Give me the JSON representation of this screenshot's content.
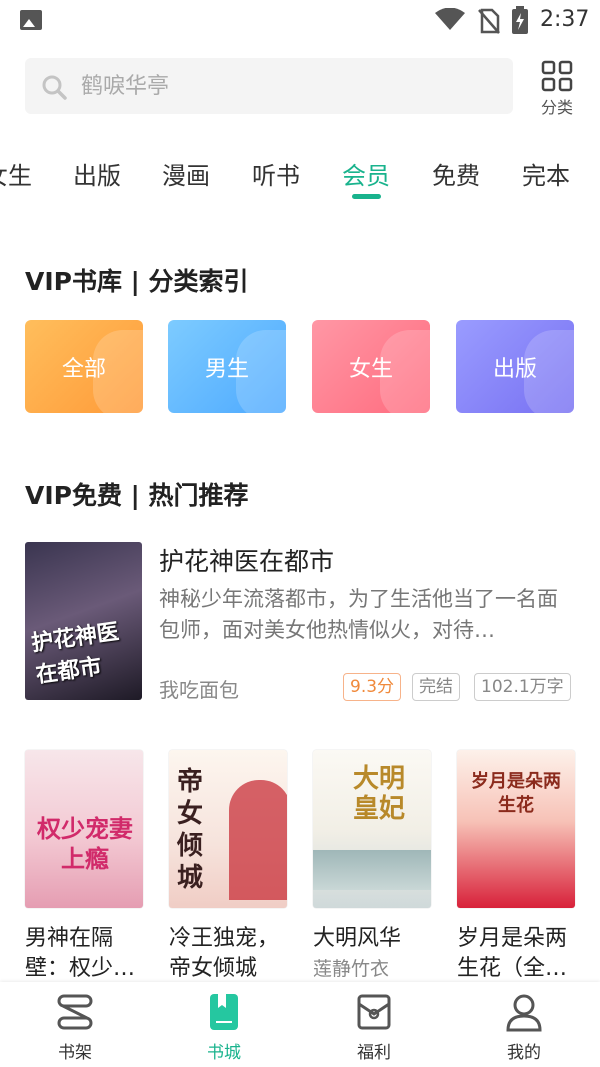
{
  "status_bar": {
    "time": "2:37"
  },
  "search": {
    "placeholder": "鹤唳华亭"
  },
  "category_button": {
    "label": "分类"
  },
  "tabs": [
    {
      "label": "女生"
    },
    {
      "label": "出版"
    },
    {
      "label": "漫画"
    },
    {
      "label": "听书"
    },
    {
      "label": "会员",
      "active": true
    },
    {
      "label": "免费"
    },
    {
      "label": "完本"
    }
  ],
  "vip_index": {
    "title": "VIP书库 | 分类索引",
    "cards": [
      {
        "label": "全部",
        "color_from": "#ffb04a",
        "color_to": "#ff9532"
      },
      {
        "label": "男生",
        "color_from": "#6fc0ff",
        "color_to": "#4aa8ff"
      },
      {
        "label": "女生",
        "color_from": "#ff8a9a",
        "color_to": "#ff6e80"
      },
      {
        "label": "出版",
        "color_from": "#8f93ff",
        "color_to": "#7a74f6"
      }
    ]
  },
  "vip_free": {
    "title": "VIP免费 | 热门推荐",
    "feature": {
      "title": "护花神医在都市",
      "description": "神秘少年流落都市，为了生活他当了一名面包师，面对美女他热情似火，对待…",
      "author": "我吃面包",
      "cover_text": "护花神医在都市",
      "tags": {
        "score": "9.3分",
        "status": "完结",
        "words": "102.1万字"
      }
    },
    "books": [
      {
        "title": "男神在隔壁：权少…",
        "author": "",
        "cover_text": "权少宠妻上瘾"
      },
      {
        "title": "冷王独宠，帝女倾城",
        "author": "",
        "cover_text": "帝女倾城"
      },
      {
        "title": "大明风华",
        "author": "莲静竹衣",
        "cover_text": "大明皇妃"
      },
      {
        "title": "岁月是朵两生花（全…",
        "author": "",
        "cover_text": "岁月是朵两生花"
      }
    ]
  },
  "bottom_nav": [
    {
      "label": "书架",
      "icon": "bookshelf-icon"
    },
    {
      "label": "书城",
      "icon": "bookstore-icon",
      "active": true
    },
    {
      "label": "福利",
      "icon": "gift-icon"
    },
    {
      "label": "我的",
      "icon": "user-icon"
    }
  ],
  "colors": {
    "accent": "#19b38d",
    "score": "#f08a3c"
  }
}
